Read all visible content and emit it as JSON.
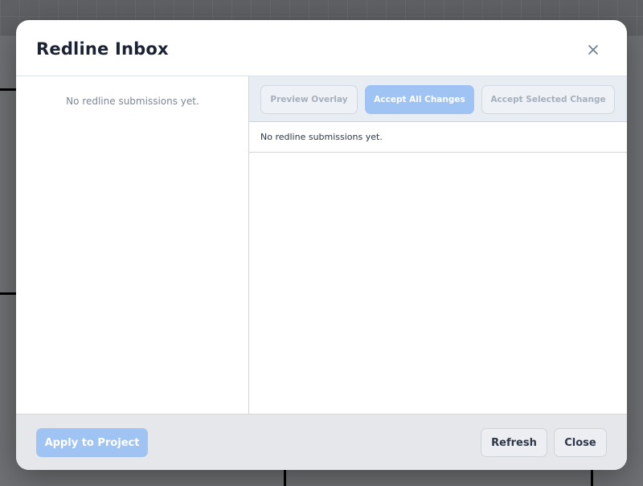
{
  "modal": {
    "title": "Redline Inbox",
    "close_icon": "close-icon"
  },
  "left_panel": {
    "empty_message": "No redline submissions yet."
  },
  "right_panel": {
    "actions": {
      "preview_overlay": "Preview Overlay",
      "accept_all": "Accept All Changes",
      "accept_selected": "Accept Selected Change"
    },
    "detail_message": "No redline submissions yet."
  },
  "footer": {
    "apply_label": "Apply to Project",
    "refresh_label": "Refresh",
    "close_label": "Close"
  },
  "colors": {
    "accent": "#9fc3f3",
    "title": "#1a2233",
    "backdrop": "#6b6d70"
  }
}
